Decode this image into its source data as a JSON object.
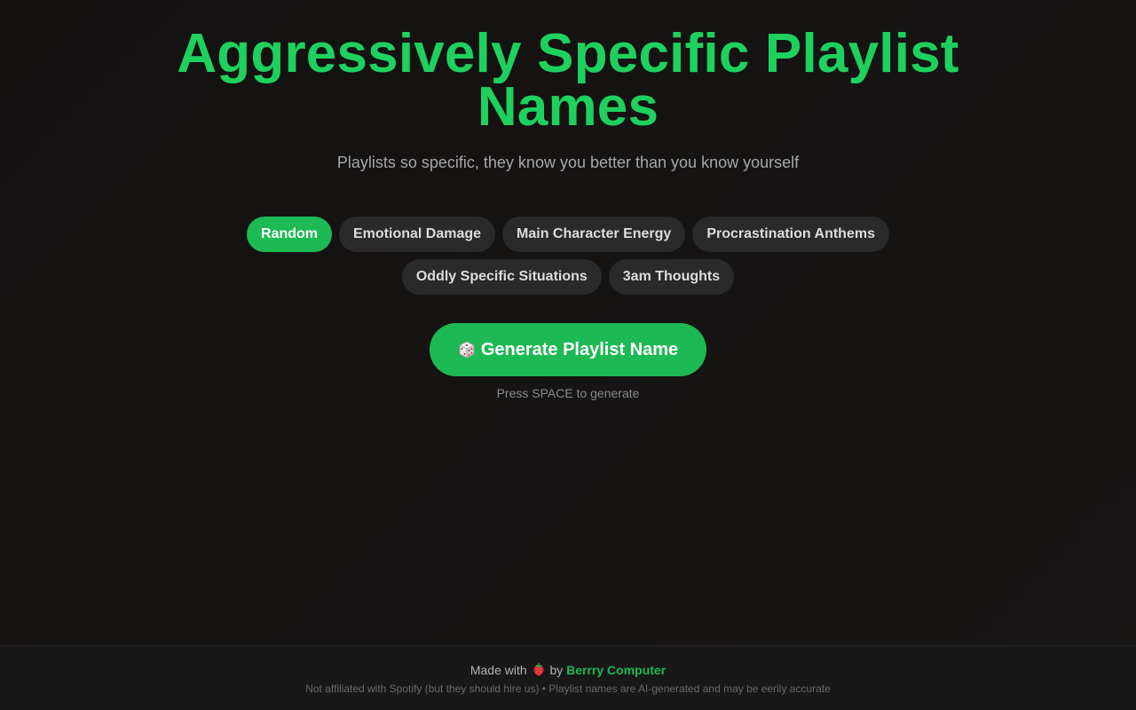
{
  "header": {
    "title_line1": "Aggressively Specific Playlist",
    "title_line2": "Names",
    "subtitle": "Playlists so specific, they know you better than you know yourself"
  },
  "categories": [
    {
      "label": "Random",
      "active": true
    },
    {
      "label": "Emotional Damage",
      "active": false
    },
    {
      "label": "Main Character Energy",
      "active": false
    },
    {
      "label": "Procrastination Anthems",
      "active": false
    },
    {
      "label": "Oddly Specific Situations",
      "active": false
    },
    {
      "label": "3am Thoughts",
      "active": false
    }
  ],
  "generate": {
    "icon": "dice-icon",
    "label": "Generate Playlist Name",
    "hint": "Press SPACE to generate"
  },
  "footer": {
    "made_with": "Made with",
    "icon": "strawberry-icon",
    "by": "by",
    "brand": "Berrry Computer",
    "disclaimer": "Not affiliated with Spotify (but they should hire us) • Playlist names are AI-generated and may be eerily accurate"
  },
  "colors": {
    "accent": "#1db954",
    "title": "#1ed15e",
    "background": "#141111",
    "chip": "#2a2a2a"
  }
}
